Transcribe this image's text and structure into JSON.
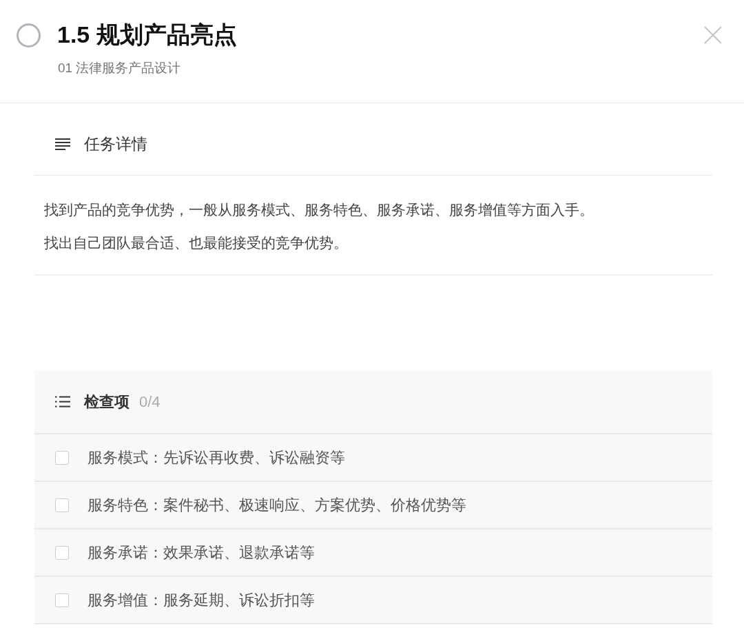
{
  "task": {
    "title": "1.5 规划产品亮点",
    "done": false,
    "project": "01 法律服务产品设计"
  },
  "details": {
    "heading": "任务详情",
    "lines": [
      "找到产品的竞争优势，一般从服务模式、服务特色、服务承诺、服务增值等方面入手。",
      "找出自己团队最合适、也最能接受的竞争优势。"
    ]
  },
  "checklist": {
    "heading": "检查项",
    "count": "0/4",
    "items": [
      {
        "text": "服务模式：先诉讼再收费、诉讼融资等",
        "checked": false
      },
      {
        "text": "服务特色：案件秘书、极速响应、方案优势、价格优势等",
        "checked": false
      },
      {
        "text": "服务承诺：效果承诺、退款承诺等",
        "checked": false
      },
      {
        "text": "服务增值：服务延期、诉讼折扣等",
        "checked": false
      }
    ]
  }
}
